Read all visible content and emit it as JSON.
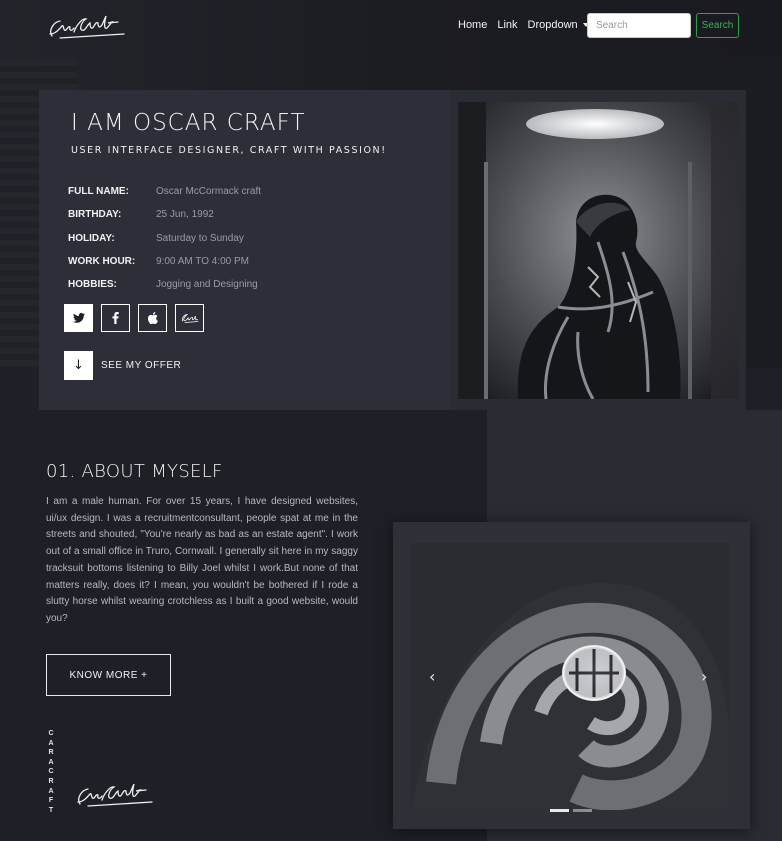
{
  "brand": {
    "name": "CaraCraft",
    "vertical": "CARACRAFT"
  },
  "nav": {
    "links": [
      "Home",
      "Link",
      "Dropdown"
    ],
    "search_placeholder": "Search",
    "search_button": "Search"
  },
  "profile": {
    "title": "I AM OSCAR CRAFT",
    "subtitle": "USER INTERFACE DESIGNER, CRAFT WITH PASSION!",
    "info": [
      {
        "label": "FULL NAME:",
        "value": "Oscar McCormack craft"
      },
      {
        "label": "BIRTHDAY:",
        "value": "25 Jun, 1992"
      },
      {
        "label": "HOLIDAY:",
        "value": "Saturday to Sunday"
      },
      {
        "label": "WORK HOUR:",
        "value": "9:00 AM TO 4:00 PM"
      },
      {
        "label": "HOBBIES:",
        "value": "Jogging and Designing"
      }
    ],
    "socials": [
      "twitter-icon",
      "facebook-icon",
      "apple-icon",
      "signature-icon"
    ],
    "offer_label": "SEE MY OFFER",
    "offer_arrow": "↓"
  },
  "about": {
    "title": "01. ABOUT MYSELF",
    "text": "I am a male human. For over 15 years, I have designed websites, ui/ux design. I was a recruitmentconsultant, people spat at me in the streets and shouted, \"You're nearly as bad as an estate agent\". I work out of a small office in Truro, Cornwall. I generally sit here in my saggy tracksuit bottoms listening to Billy Joel whilst I work.But none of that matters really, does it? I mean, you wouldn't be bothered if I rode a slutty horse whilst wearing crotchless as I built a good website, would you?",
    "button": "KNOW MORE +"
  },
  "carousel": {
    "prev": "‹",
    "next": "›",
    "slides": 2,
    "active": 0
  },
  "colors": {
    "bg": "#1f2027",
    "card": "#2d2f38",
    "accent_green": "#3cb35a"
  }
}
